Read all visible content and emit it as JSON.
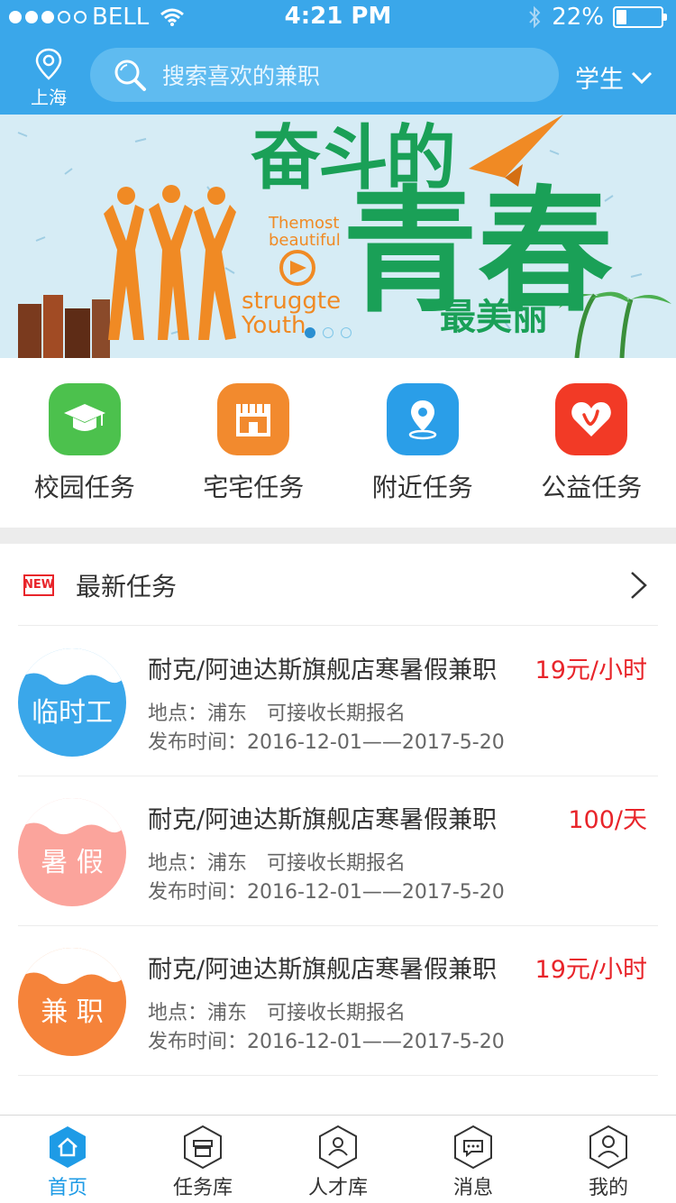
{
  "status": {
    "carrier": "BELL",
    "time": "4:21 PM",
    "battery": "22%"
  },
  "header": {
    "city": "上海",
    "search_placeholder": "搜索喜欢的兼职",
    "role": "学生"
  },
  "banner": {
    "title_line1": "奋斗的",
    "title_line2": "青春",
    "title_line3": "最美丽",
    "eng_top": "Themost\nbeautiful",
    "eng_bottom": "struggte\nYouth"
  },
  "categories": [
    {
      "label": "校园任务",
      "icon": "graduation-cap-icon",
      "color": "#4cc14d"
    },
    {
      "label": "宅宅任务",
      "icon": "store-icon",
      "color": "#f28a2e"
    },
    {
      "label": "附近任务",
      "icon": "map-pin-icon",
      "color": "#2a9ee8"
    },
    {
      "label": "公益任务",
      "icon": "heart-icon",
      "color": "#f23a26"
    }
  ],
  "latest": {
    "new_badge": "NEW",
    "title": "最新任务"
  },
  "tasks": [
    {
      "badge": "临时工",
      "badge_color": "#3aa7ea",
      "name": "耐克/阿迪达斯旗舰店寒暑假兼职",
      "price": "19元/小时",
      "location": "地点：浦东",
      "note": "可接收长期报名",
      "date": "发布时间：2016-12-01——2017-5-20"
    },
    {
      "badge": "暑 假",
      "badge_color": "#fba49c",
      "name": "耐克/阿迪达斯旗舰店寒暑假兼职",
      "price": "100/天",
      "location": "地点：浦东",
      "note": "可接收长期报名",
      "date": "发布时间：2016-12-01——2017-5-20"
    },
    {
      "badge": "兼 职",
      "badge_color": "#f5833a",
      "name": "耐克/阿迪达斯旗舰店寒暑假兼职",
      "price": "19元/小时",
      "location": "地点：浦东",
      "note": "可接收长期报名",
      "date": "发布时间：2016-12-01——2017-5-20"
    }
  ],
  "tabs": [
    {
      "label": "首页",
      "icon": "home-icon",
      "active": true
    },
    {
      "label": "任务库",
      "icon": "task-library-icon",
      "active": false
    },
    {
      "label": "人才库",
      "icon": "talent-icon",
      "active": false
    },
    {
      "label": "消息",
      "icon": "message-icon",
      "active": false
    },
    {
      "label": "我的",
      "icon": "profile-icon",
      "active": false
    }
  ],
  "colors": {
    "primary": "#3aa7ea",
    "price": "#e8242a",
    "tab_active": "#1e9be6"
  }
}
